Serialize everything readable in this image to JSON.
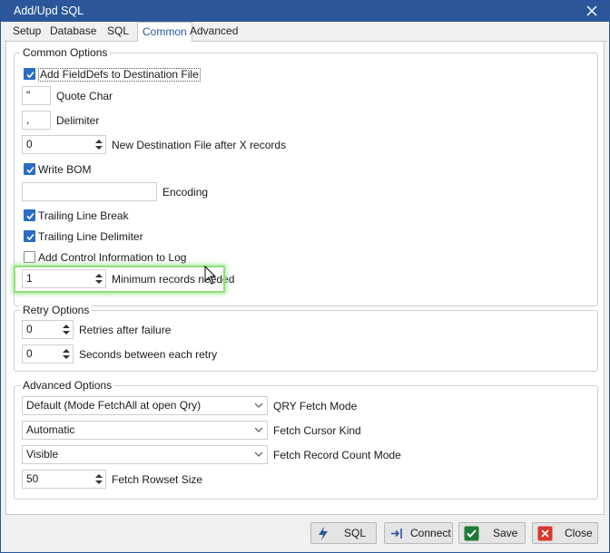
{
  "window": {
    "title": "Add/Upd SQL"
  },
  "tabs": [
    {
      "label": "Setup"
    },
    {
      "label": "Database"
    },
    {
      "label": "SQL"
    },
    {
      "label": "Common",
      "active": true
    },
    {
      "label": "Advanced"
    }
  ],
  "common_options": {
    "title": "Common Options",
    "add_fielddefs": {
      "label": "Add FieldDefs to Destination File",
      "checked": true
    },
    "quote_char": {
      "value": "\"",
      "label": "Quote Char"
    },
    "delimiter": {
      "value": ",",
      "label": "Delimiter"
    },
    "new_file_after": {
      "value": "0",
      "label": "New Destination File after X records"
    },
    "write_bom": {
      "label": "Write BOM",
      "checked": true
    },
    "encoding": {
      "value": "",
      "label": "Encoding"
    },
    "trailing_line_break": {
      "label": "Trailing Line Break",
      "checked": true
    },
    "trailing_line_delimiter": {
      "label": "Trailing Line Delimiter",
      "checked": true
    },
    "add_control_info": {
      "label": "Add Control Information to Log",
      "checked": false
    },
    "min_records": {
      "value": "1",
      "label": "Minimum records needed"
    }
  },
  "retry_options": {
    "title": "Retry Options",
    "retries": {
      "value": "0",
      "label": "Retries after failure"
    },
    "seconds": {
      "value": "0",
      "label": "Seconds between each retry"
    }
  },
  "advanced_options": {
    "title": "Advanced Options",
    "qry_fetch_mode": {
      "value": "Default (Mode FetchAll at open Qry)",
      "label": "QRY Fetch Mode"
    },
    "fetch_cursor_kind": {
      "value": "Automatic",
      "label": "Fetch Cursor Kind"
    },
    "fetch_record_count_mode": {
      "value": "Visible",
      "label": "Fetch Record Count Mode"
    },
    "fetch_rowset_size": {
      "value": "50",
      "label": "Fetch Rowset Size"
    }
  },
  "buttons": {
    "sql": "SQL",
    "connect": "Connect",
    "save": "Save",
    "close": "Close"
  },
  "colors": {
    "accent": "#2b579a",
    "checkbox": "#2b6cc4",
    "highlight": "#8ee07a",
    "save_icon": "#1e7b34",
    "close_icon": "#d9372b"
  }
}
